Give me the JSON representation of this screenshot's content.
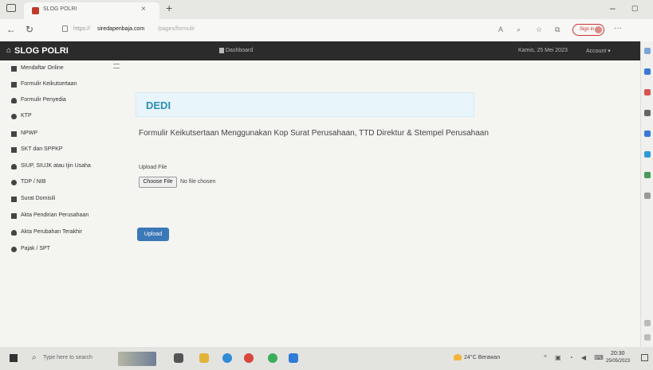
{
  "browser": {
    "tab_title": "SLOG POLRI",
    "url_protocol": "https://",
    "url_host": "siredapenbaja.com",
    "url_path": "/pages/formulir",
    "signin_label": "Sign in"
  },
  "navbar": {
    "brand": "SLOG POLRI",
    "dashboard": "Dashboard",
    "date": "Kamis, 25 Mei 2023",
    "account": "Account ▾"
  },
  "sidebar": {
    "items": [
      {
        "label": "Mendaftar Online",
        "icon": "home-icon"
      },
      {
        "label": "Formulir Keikutsertaan",
        "icon": "grid-icon"
      },
      {
        "label": "Formulir Penyedia",
        "icon": "user-icon"
      },
      {
        "label": "KTP",
        "icon": "circle-icon"
      },
      {
        "label": "NPWP",
        "icon": "home-icon"
      },
      {
        "label": "SKT dan SPPKP",
        "icon": "grid-icon"
      },
      {
        "label": "SIUP, SIUJK atau Ijin Usaha",
        "icon": "user-icon"
      },
      {
        "label": "TDP / NIB",
        "icon": "circle-icon"
      },
      {
        "label": "Surat Domisili",
        "icon": "home-icon"
      },
      {
        "label": "Akta Pendirian Perusahaan",
        "icon": "grid-icon"
      },
      {
        "label": "Akta Perubahan Terakhir",
        "icon": "user-icon"
      },
      {
        "label": "Pajak / SPT",
        "icon": "circle-icon"
      }
    ]
  },
  "main": {
    "header": "DEDI",
    "description": "Formulir Keikutsertaan Menggunakan Kop Surat Perusahaan, TTD Direktur & Stempel Perusahaan",
    "upload_label": "Upload File",
    "choose_file": "Choose File",
    "no_file": "No file chosen",
    "upload_button": "Upload"
  },
  "taskbar": {
    "search_placeholder": "Type here to search",
    "weather": "24°C  Berawan",
    "time": "20:30",
    "date": "25/05/2023"
  },
  "colors": {
    "navbar": "#2b2b2b",
    "header_bg": "#e8f5fa",
    "header_text": "#2a8fb8",
    "upload_button": "#3b78b8"
  }
}
